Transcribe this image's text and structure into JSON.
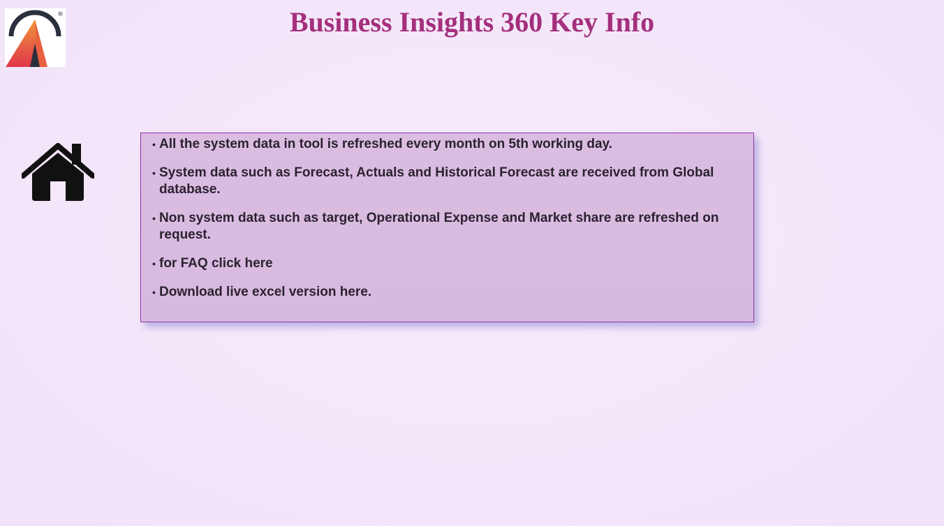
{
  "header": {
    "title": "Business Insights 360 Key Info",
    "logo": {
      "icon": "brand-logo-a",
      "registered_mark": "®",
      "colors": {
        "ring": "#2a2f3d",
        "gradient_top": "#f0963a",
        "gradient_bottom": "#e0364a"
      }
    }
  },
  "nav": {
    "home_icon": "home-icon"
  },
  "info": {
    "bullet": "•",
    "items": [
      {
        "text": "All the system data in tool is refreshed every month on 5th working day."
      },
      {
        "text": "System data such as Forecast, Actuals and Historical Forecast are received from Global database."
      },
      {
        "text": "Non system data such as target, Operational Expense and Market share are refreshed on request."
      },
      {
        "text": "for FAQ click here"
      },
      {
        "text": "Download live excel version here."
      }
    ]
  },
  "colors": {
    "title": "#a42f7c",
    "box_border": "#8b35a8",
    "box_fill": "#dbbde2",
    "text": "#2b2230",
    "background": "#f5e8fa"
  }
}
